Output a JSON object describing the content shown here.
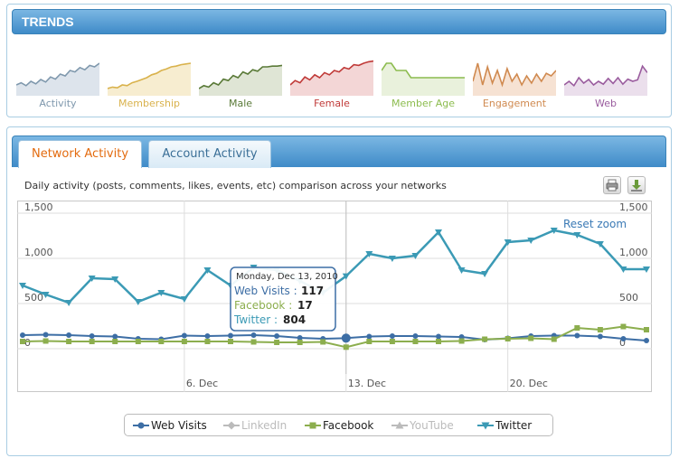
{
  "trends": {
    "title": "TRENDS",
    "items": [
      {
        "label": "Activity",
        "color": "#7f98ad",
        "fill": "#dde4ec",
        "values": [
          30,
          36,
          28,
          40,
          33,
          45,
          38,
          52,
          46,
          60,
          55,
          70,
          66,
          78,
          72,
          84,
          80,
          90
        ]
      },
      {
        "label": "Membership",
        "color": "#d9b24c",
        "fill": "#f7edd0",
        "values": [
          20,
          24,
          22,
          30,
          28,
          36,
          40,
          45,
          50,
          58,
          62,
          70,
          74,
          80,
          82,
          86,
          88,
          90
        ]
      },
      {
        "label": "Male",
        "color": "#5a7a38",
        "fill": "#dfe5d5",
        "values": [
          20,
          28,
          24,
          36,
          30,
          46,
          42,
          56,
          50,
          66,
          60,
          72,
          68,
          80,
          80,
          82,
          82,
          84
        ]
      },
      {
        "label": "Female",
        "color": "#c03a38",
        "fill": "#f3d6d6",
        "values": [
          30,
          42,
          36,
          52,
          44,
          58,
          50,
          64,
          58,
          70,
          66,
          78,
          74,
          86,
          84,
          90,
          94,
          96
        ]
      },
      {
        "label": "Member Age",
        "color": "#8cbc4e",
        "fill": "#e9f1dc",
        "values": [
          70,
          90,
          90,
          70,
          70,
          70,
          50,
          50,
          50,
          50,
          50,
          50,
          50,
          50,
          50,
          50,
          50,
          50
        ]
      },
      {
        "label": "Engagement",
        "color": "#d08a50",
        "fill": "#f6e2d3",
        "values": [
          40,
          90,
          30,
          80,
          35,
          70,
          30,
          75,
          40,
          60,
          30,
          55,
          35,
          60,
          40,
          62,
          55,
          70
        ]
      },
      {
        "label": "Web",
        "color": "#9a5c9e",
        "fill": "#ebdfec",
        "values": [
          30,
          40,
          28,
          50,
          35,
          45,
          30,
          40,
          32,
          48,
          34,
          50,
          32,
          46,
          40,
          44,
          82,
          64
        ]
      }
    ]
  },
  "tabs": [
    {
      "label": "Network Activity",
      "active": true
    },
    {
      "label": "Account Activity",
      "active": false
    }
  ],
  "subtitle": "Daily activity (posts, comments, likes, events, etc) comparison across your networks",
  "toolbar": {
    "print_icon": "printer-icon",
    "export_icon": "download-icon"
  },
  "reset_zoom_label": "Reset zoom",
  "chart_data": {
    "type": "line",
    "x": [
      "Nov 29",
      "Nov 30",
      "Dec 1",
      "Dec 2",
      "Dec 3",
      "Dec 4",
      "Dec 5",
      "Dec 6",
      "Dec 7",
      "Dec 8",
      "Dec 9",
      "Dec 10",
      "Dec 11",
      "Dec 12",
      "Dec 13",
      "Dec 14",
      "Dec 15",
      "Dec 16",
      "Dec 17",
      "Dec 18",
      "Dec 19",
      "Dec 20",
      "Dec 21",
      "Dec 22",
      "Dec 23",
      "Dec 24",
      "Dec 25",
      "Dec 26"
    ],
    "xticks": [
      "6. Dec",
      "13. Dec",
      "20. Dec"
    ],
    "xtick_index": [
      7,
      14,
      21
    ],
    "yticks": [
      "0",
      "500",
      "1,000",
      "1,500"
    ],
    "ylim": [
      0,
      1500
    ],
    "grid": true,
    "legend_position": "bottom",
    "series": [
      {
        "name": "Web Visits",
        "color": "#3d6ea5",
        "marker": "circle",
        "visible": true,
        "values": [
          150,
          155,
          150,
          140,
          135,
          110,
          105,
          145,
          140,
          145,
          150,
          140,
          120,
          110,
          117,
          135,
          140,
          140,
          135,
          130,
          100,
          115,
          140,
          145,
          145,
          135,
          110,
          90
        ]
      },
      {
        "name": "LinkedIn",
        "color": "#bbbbbb",
        "marker": "diamond",
        "visible": false,
        "values": []
      },
      {
        "name": "Facebook",
        "color": "#8cae4e",
        "marker": "square",
        "visible": true,
        "values": [
          80,
          85,
          80,
          80,
          80,
          80,
          80,
          80,
          80,
          80,
          75,
          70,
          70,
          75,
          17,
          80,
          80,
          80,
          80,
          85,
          105,
          110,
          115,
          105,
          230,
          210,
          245,
          210
        ]
      },
      {
        "name": "YouTube",
        "color": "#bbbbbb",
        "marker": "triangle",
        "visible": false,
        "values": []
      },
      {
        "name": "Twitter",
        "color": "#3b9ab5",
        "marker": "triangle-down",
        "visible": true,
        "values": [
          700,
          600,
          510,
          780,
          770,
          520,
          620,
          550,
          870,
          700,
          900,
          870,
          750,
          620,
          804,
          1050,
          1000,
          1030,
          1290,
          870,
          830,
          1180,
          1200,
          1310,
          1260,
          1160,
          880,
          880
        ]
      }
    ]
  },
  "tooltip": {
    "date": "Monday, Dec 13, 2010",
    "rows": [
      {
        "label": "Web Visits",
        "value": "117",
        "color": "#3d6ea5"
      },
      {
        "label": "Facebook",
        "value": "17",
        "color": "#8cae4e"
      },
      {
        "label": "Twitter",
        "value": "804",
        "color": "#3b9ab5"
      }
    ]
  },
  "legend": [
    {
      "label": "Web Visits",
      "color": "#3d6ea5",
      "marker": "circle",
      "active": true
    },
    {
      "label": "LinkedIn",
      "color": "#bbbbbb",
      "marker": "diamond",
      "active": false
    },
    {
      "label": "Facebook",
      "color": "#8cae4e",
      "marker": "square",
      "active": true
    },
    {
      "label": "YouTube",
      "color": "#bbbbbb",
      "marker": "triangle",
      "active": false
    },
    {
      "label": "Twitter",
      "color": "#3b9ab5",
      "marker": "triangle-down",
      "active": true
    }
  ]
}
